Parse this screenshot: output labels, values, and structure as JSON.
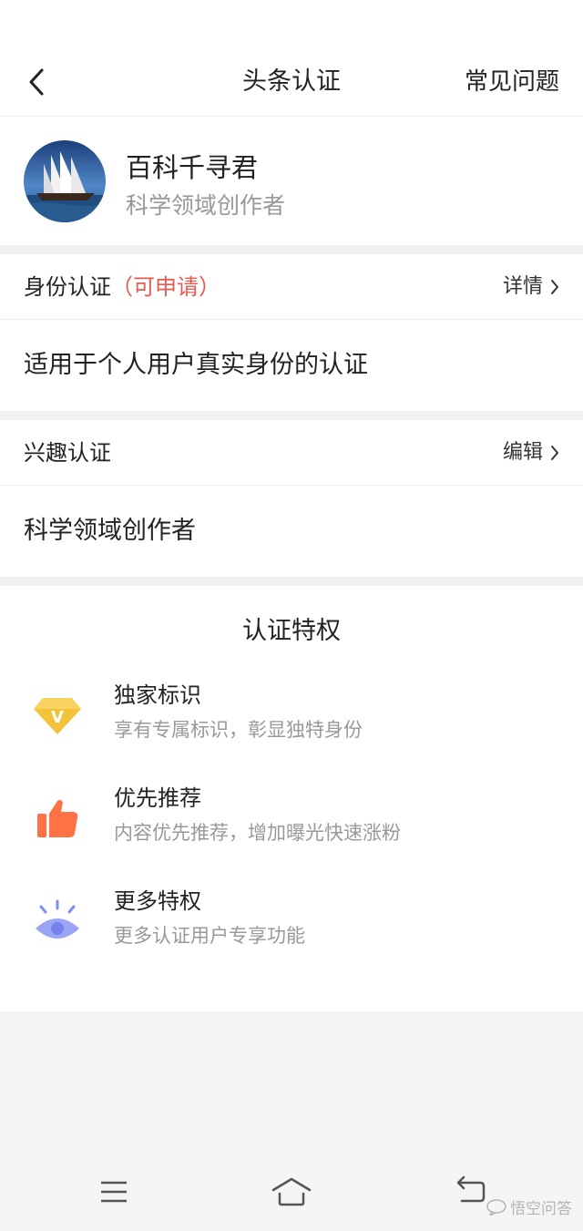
{
  "nav": {
    "title": "头条认证",
    "right_label": "常见问题"
  },
  "profile": {
    "name": "百科千寻君",
    "subtitle": "科学领域创作者"
  },
  "identity_card": {
    "title": "身份认证",
    "tag": "（可申请）",
    "action": "详情",
    "body": "适用于个人用户真实身份的认证"
  },
  "interest_card": {
    "title": "兴趣认证",
    "action": "编辑",
    "body": "科学领域创作者"
  },
  "privileges": {
    "title": "认证特权",
    "items": [
      {
        "name": "独家标识",
        "desc": "享有专属标识，彰显独特身份",
        "icon": "diamond-v-icon"
      },
      {
        "name": "优先推荐",
        "desc": "内容优先推荐，增加曝光快速涨粉",
        "icon": "thumbs-up-icon"
      },
      {
        "name": "更多特权",
        "desc": "更多认证用户专享功能",
        "icon": "eye-icon"
      }
    ]
  },
  "colors": {
    "accent_red": "#e85a4f",
    "gold": "#f5c33b",
    "orange": "#ff7245",
    "lavender": "#9aa6f5"
  },
  "watermark": "悟空问答"
}
